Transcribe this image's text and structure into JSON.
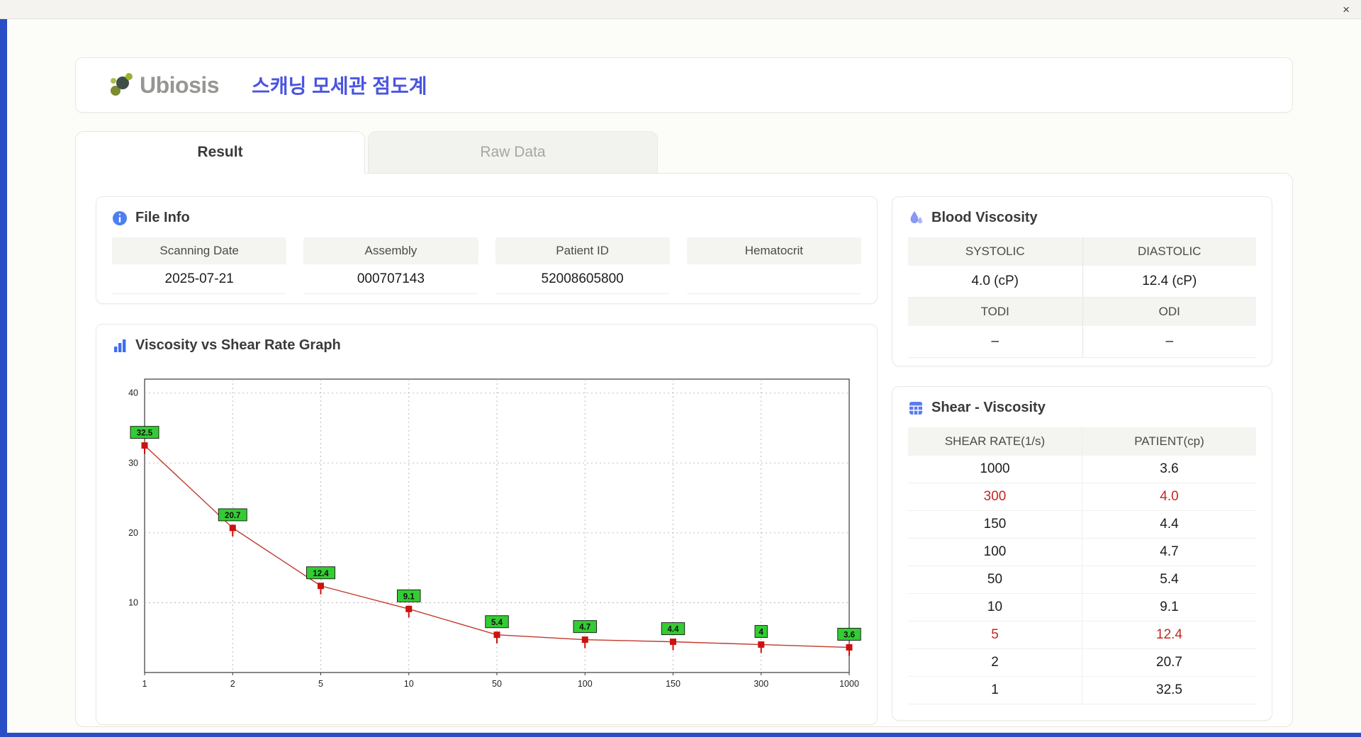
{
  "window": {
    "close": "×"
  },
  "header": {
    "brand": "Ubiosis",
    "title": "스캐닝 모세관 점도계"
  },
  "tabs": {
    "result": "Result",
    "raw": "Raw Data"
  },
  "file_info": {
    "title": "File Info",
    "fields": [
      {
        "label": "Scanning Date",
        "value": "2025-07-21"
      },
      {
        "label": "Assembly",
        "value": "000707143"
      },
      {
        "label": "Patient ID",
        "value": "52008605800"
      },
      {
        "label": "Hematocrit",
        "value": ""
      }
    ]
  },
  "blood_viscosity": {
    "title": "Blood Viscosity",
    "systolic_label": "SYSTOLIC",
    "systolic_value": "4.0 (cP)",
    "diastolic_label": "DIASTOLIC",
    "diastolic_value": "12.4 (cP)",
    "todi_label": "TODI",
    "todi_value": "–",
    "odi_label": "ODI",
    "odi_value": "–"
  },
  "graph": {
    "title": "Viscosity vs Shear Rate Graph"
  },
  "chart_data": {
    "type": "line",
    "title": "Viscosity vs Shear Rate Graph",
    "x": [
      1,
      2,
      5,
      10,
      50,
      100,
      150,
      300,
      1000
    ],
    "x_tick_labels": [
      "1",
      "2",
      "5",
      "10",
      "50",
      "100",
      "150",
      "300",
      "1000"
    ],
    "values": [
      32.5,
      20.7,
      12.4,
      9.1,
      5.4,
      4.7,
      4.4,
      4,
      3.6
    ],
    "point_labels": [
      "32.5",
      "20.7",
      "12.4",
      "9.1",
      "5.4",
      "4.7",
      "4.4",
      "4",
      "3.6"
    ],
    "xlabel": "",
    "ylabel": "",
    "ylim": [
      0,
      42
    ],
    "yticks": [
      10,
      20,
      30,
      40
    ],
    "x_scale": "category",
    "grid": true,
    "line_color": "#c0392b",
    "marker_color": "#cc1111",
    "label_bg": "#33cc33",
    "label_border": "#111111"
  },
  "shear_table": {
    "title": "Shear - Viscosity",
    "columns": [
      "SHEAR RATE(1/s)",
      "PATIENT(cp)"
    ],
    "highlight_color": "#c4271f",
    "rows": [
      {
        "shear": "1000",
        "patient": "3.6"
      },
      {
        "shear": "300",
        "patient": "4.0"
      },
      {
        "shear": "150",
        "patient": "4.4"
      },
      {
        "shear": "100",
        "patient": "4.7"
      },
      {
        "shear": "50",
        "patient": "5.4"
      },
      {
        "shear": "10",
        "patient": "9.1"
      },
      {
        "shear": "5",
        "patient": "12.4"
      },
      {
        "shear": "2",
        "patient": "20.7"
      },
      {
        "shear": "1",
        "patient": "32.5"
      }
    ]
  }
}
